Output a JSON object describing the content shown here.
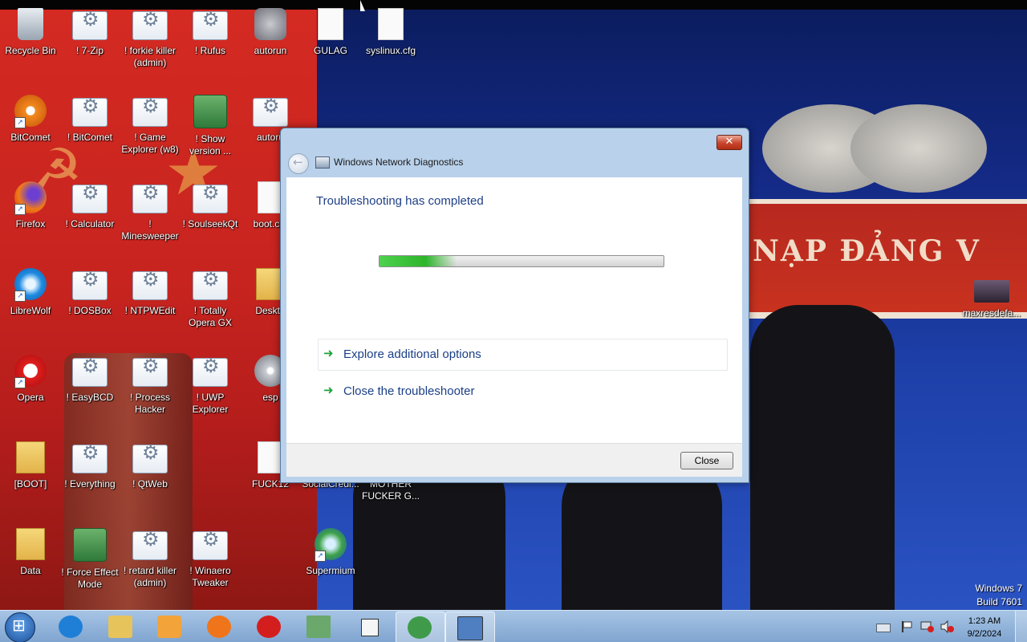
{
  "desktop": {
    "banner_text": "NẠP ĐẢNG V",
    "watermark": {
      "line1": "Windows 7",
      "line2": "Build 7601"
    },
    "icons": [
      {
        "label": "Recycle Bin",
        "icon": "recycle-bin-icon"
      },
      {
        "label": "! 7-Zip",
        "icon": "gear-icon"
      },
      {
        "label": "! forkie killer (admin)",
        "icon": "gear-icon"
      },
      {
        "label": "! Rufus",
        "icon": "gear-icon"
      },
      {
        "label": "autorun",
        "icon": "wolf-icon"
      },
      {
        "label": "GULAG",
        "icon": "file-icon"
      },
      {
        "label": "syslinux.cfg",
        "icon": "file-icon"
      },
      {
        "label": "BitComet",
        "icon": "bitcomet-icon"
      },
      {
        "label": "! BitComet",
        "icon": "gear-icon"
      },
      {
        "label": "! Game Explorer (w8)",
        "icon": "gear-icon"
      },
      {
        "label": "! Show version ...",
        "icon": "app-icon"
      },
      {
        "label": "autoru",
        "icon": "gear-icon"
      },
      {
        "label": "Firefox",
        "icon": "firefox-icon"
      },
      {
        "label": "! Calculator",
        "icon": "gear-icon"
      },
      {
        "label": "! Minesweeper",
        "icon": "gear-icon"
      },
      {
        "label": "! SoulseekQt",
        "icon": "gear-icon"
      },
      {
        "label": "boot.cat",
        "icon": "file-icon"
      },
      {
        "label": "LibreWolf",
        "icon": "librewolf-icon"
      },
      {
        "label": "! DOSBox",
        "icon": "gear-icon"
      },
      {
        "label": "! NTPWEdit",
        "icon": "gear-icon"
      },
      {
        "label": "! Totally Opera GX",
        "icon": "gear-icon"
      },
      {
        "label": "Deskto",
        "icon": "folder-icon"
      },
      {
        "label": "Opera",
        "icon": "opera-icon"
      },
      {
        "label": "! EasyBCD",
        "icon": "gear-icon"
      },
      {
        "label": "! Process Hacker",
        "icon": "gear-icon"
      },
      {
        "label": "! UWP Explorer",
        "icon": "gear-icon"
      },
      {
        "label": "esp",
        "icon": "disc-icon"
      },
      {
        "label": "[BOOT]",
        "icon": "folder-icon"
      },
      {
        "label": "! Everything",
        "icon": "gear-icon"
      },
      {
        "label": "! QtWeb",
        "icon": "gear-icon"
      },
      {
        "label": "FUCK12",
        "icon": "file-icon"
      },
      {
        "label": "SocialCredi...",
        "icon": "file-icon"
      },
      {
        "label": "MOTHER FUCKER G...",
        "icon": "file-icon"
      },
      {
        "label": "Data",
        "icon": "folder-icon"
      },
      {
        "label": "! Force Effect Mode",
        "icon": "app-icon"
      },
      {
        "label": "! retard killer (admin)",
        "icon": "gear-icon"
      },
      {
        "label": "! Winaero Tweaker",
        "icon": "gear-icon"
      },
      {
        "label": "Supermium",
        "icon": "supermium-icon"
      },
      {
        "label": "maxresdefa...",
        "icon": "photo-icon"
      }
    ]
  },
  "dialog": {
    "title": "Windows Network Diagnostics",
    "heading": "Troubleshooting has completed",
    "progress_fraction": 0.27,
    "commands": [
      {
        "label": "Explore additional options"
      },
      {
        "label": "Close the troubleshooter"
      }
    ],
    "close_button": "Close",
    "close_x": "✕"
  },
  "taskbar": {
    "clock_time": "1:23 AM",
    "clock_date": "9/2/2024",
    "buttons": [
      {
        "name": "internet-explorer-icon",
        "color": "#1f7fd6"
      },
      {
        "name": "file-explorer-icon",
        "color": "#e7c35b"
      },
      {
        "name": "media-player-icon",
        "color": "#f2a33a"
      },
      {
        "name": "firefox-icon",
        "color": "#f0751a"
      },
      {
        "name": "opera-icon",
        "color": "#d41e1e"
      },
      {
        "name": "notepad-icon",
        "color": "#6aa86b"
      },
      {
        "name": "window-icon",
        "color": "#f5f5f5"
      },
      {
        "name": "network-diagnostics-icon",
        "color": "#3f9b4a"
      },
      {
        "name": "remote-desktop-icon",
        "color": "#4f7fc0"
      }
    ]
  }
}
